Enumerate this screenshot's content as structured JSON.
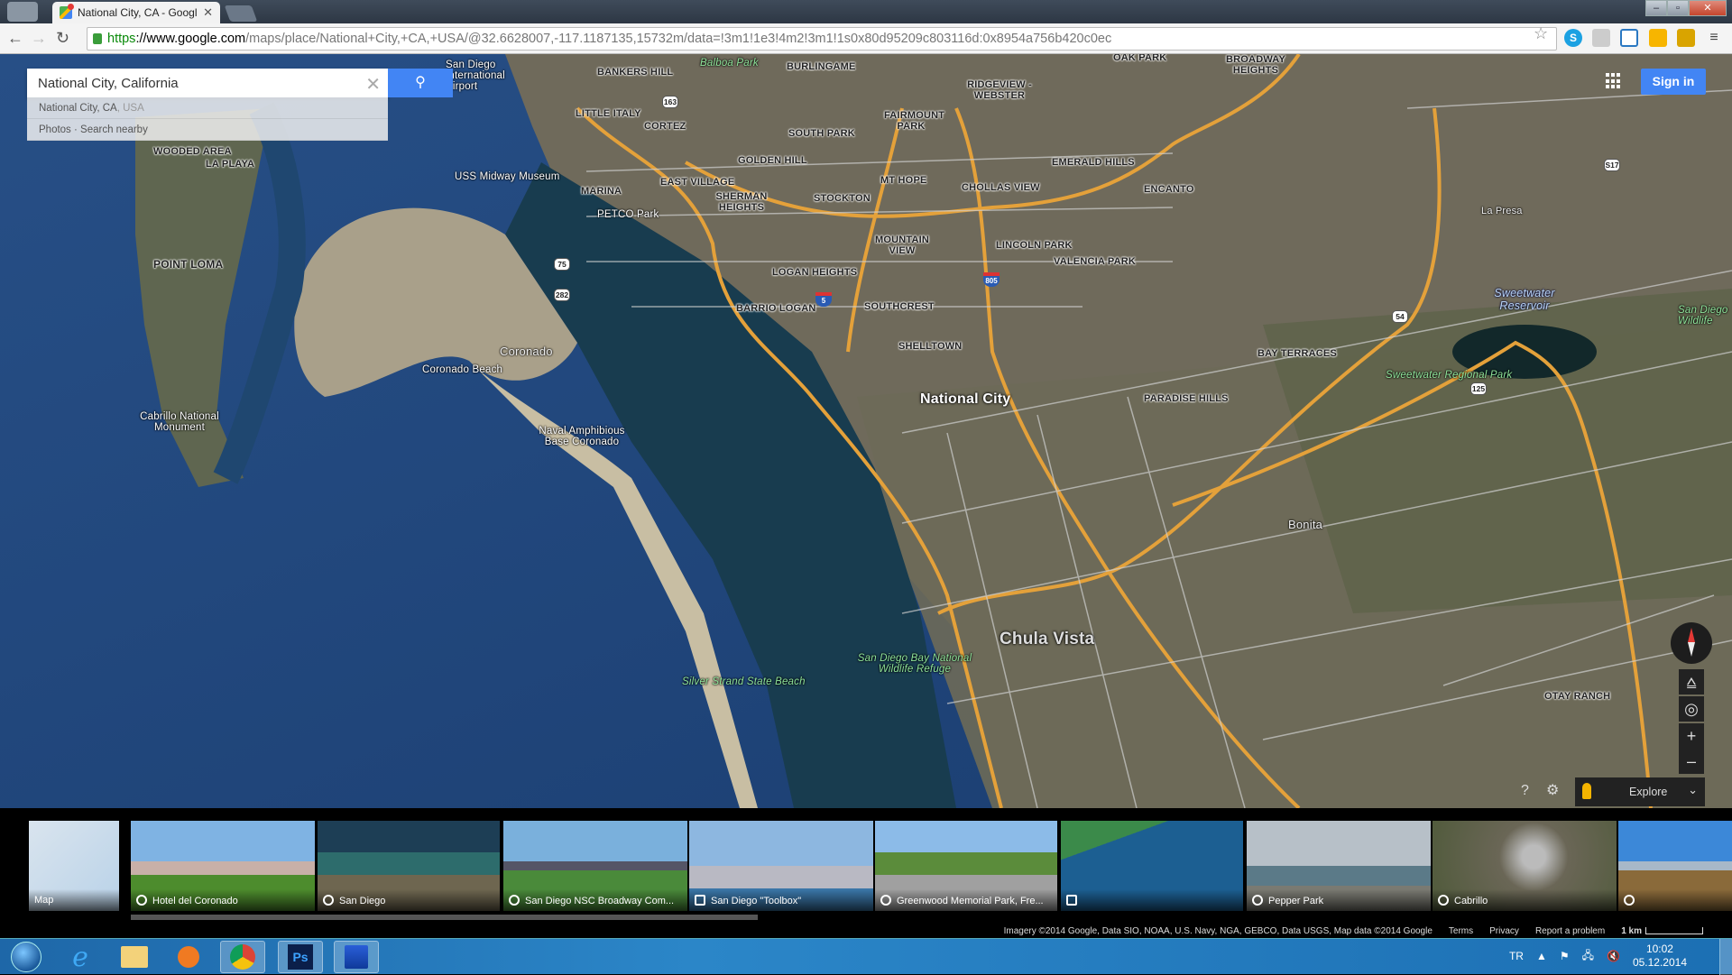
{
  "browser": {
    "tab_title": "National City, CA - Googl",
    "url_scheme": "https",
    "url_host": "://www.google.com",
    "url_path": "/maps/place/National+City,+CA,+USA/@32.6628007,-117.1187135,15732m/data=!3m1!1e3!4m2!3m1!1s0x80d95209c803116d:0x8954a756b420c0ec",
    "window_buttons": [
      "minimize",
      "maximize",
      "close"
    ],
    "extensions": [
      "skype-icon",
      "shield-icon",
      "screen-capture-icon",
      "chart-icon",
      "ruler-icon",
      "menu-icon"
    ]
  },
  "maps": {
    "search": {
      "value": "National City, California",
      "suggestions": [
        {
          "main": "National City, CA",
          "secondary": ", USA"
        },
        {
          "main": "Photos · Search nearby",
          "secondary": ""
        }
      ]
    },
    "sign_in_label": "Sign in",
    "explore_label": "Explore",
    "labels": {
      "neighborhoods": [
        "BANKERS HILL",
        "BURLINGAME",
        "LITTLE ITALY",
        "CORTEZ",
        "SOUTH PARK",
        "FAIRMOUNT PARK",
        "RIDGEVIEW - WEBSTER",
        "GOLDEN HILL",
        "EMERALD HILLS",
        "EAST VILLAGE",
        "MARINA",
        "MT HOPE",
        "CHOLLAS VIEW",
        "ENCANTO",
        "SHERMAN HEIGHTS",
        "STOCKTON",
        "MOUNTAIN VIEW",
        "LINCOLN PARK",
        "VALENCIA PARK",
        "LOGAN HEIGHTS",
        "BARRIO LOGAN",
        "SOUTHCREST",
        "SHELLTOWN",
        "POINT LOMA",
        "WOODED AREA",
        "LA PLAYA",
        "BAY TERRACES",
        "PARADISE HILLS",
        "OTAY RANCH",
        "OAK PARK",
        "BROADWAY HEIGHTS"
      ],
      "cities": [
        "National City",
        "Chula Vista",
        "Coronado",
        "Bonita",
        "La Presa"
      ],
      "pois": [
        "USS Midway Museum",
        "PETCO Park",
        "Coronado Beach",
        "Cabrillo National Monument",
        "Naval Amphibious Base Coronado",
        "San Diego International Airport"
      ],
      "parks": [
        "Balboa Park",
        "Sweetwater Regional Park",
        "San Diego Bay National Wildlife Refuge",
        "Silver Strand State Beach",
        "San Diego Wildlife"
      ],
      "water": [
        "Sweetwater Reservoir"
      ],
      "routes": [
        "163",
        "5",
        "805",
        "54",
        "75",
        "282",
        "125",
        "S17"
      ]
    },
    "filmstrip": [
      {
        "caption": "Map",
        "icon": "map-icon"
      },
      {
        "caption": "Hotel del Coronado",
        "icon": "photosphere-icon"
      },
      {
        "caption": "San Diego",
        "icon": "globe-icon"
      },
      {
        "caption": "San Diego NSC Broadway Com...",
        "icon": "photosphere-icon"
      },
      {
        "caption": "San Diego \"Toolbox\"",
        "icon": "camera-icon"
      },
      {
        "caption": "Greenwood Memorial Park, Fre...",
        "icon": "streetview-icon"
      },
      {
        "caption": "",
        "icon": "camera-icon"
      },
      {
        "caption": "Pepper Park",
        "icon": "photosphere-icon"
      },
      {
        "caption": "Cabrillo",
        "icon": "globe-icon"
      },
      {
        "caption": "",
        "icon": "streetview-icon"
      }
    ],
    "footer": {
      "attribution": "Imagery ©2014 Google, Data SIO, NOAA, U.S. Navy, NGA, GEBCO, Data USGS, Map data ©2014 Google",
      "terms": "Terms",
      "privacy": "Privacy",
      "report": "Report a problem",
      "scale": "1 km"
    }
  },
  "taskbar": {
    "apps": [
      "start-button",
      "internet-explorer",
      "file-explorer",
      "media-player",
      "chrome",
      "photoshop",
      "remote-desktop"
    ],
    "language": "TR",
    "time": "10:02",
    "date": "05.12.2014"
  }
}
